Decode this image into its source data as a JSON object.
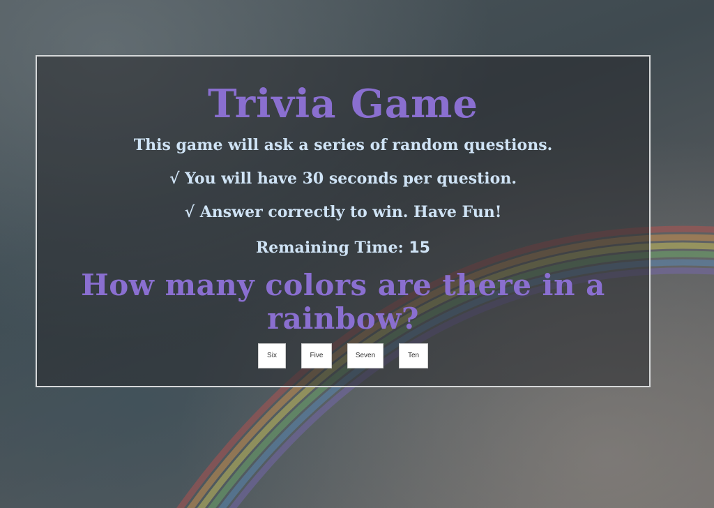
{
  "game": {
    "title": "Trivia Game",
    "intro": "This game will ask a series of random questions.",
    "rules": [
      "√ You will have 30 seconds per question.",
      "√ Answer correctly to win. Have Fun!"
    ],
    "timer": {
      "label": "Remaining Time: ",
      "value": "15"
    },
    "question": "How many colors are there in a rainbow?",
    "answers": [
      "Six",
      "Five",
      "Seven",
      "Ten"
    ]
  },
  "colors": {
    "title": "#8a6fd0",
    "text": "#cfe3f5",
    "panel_border": "#d6d8d9"
  }
}
